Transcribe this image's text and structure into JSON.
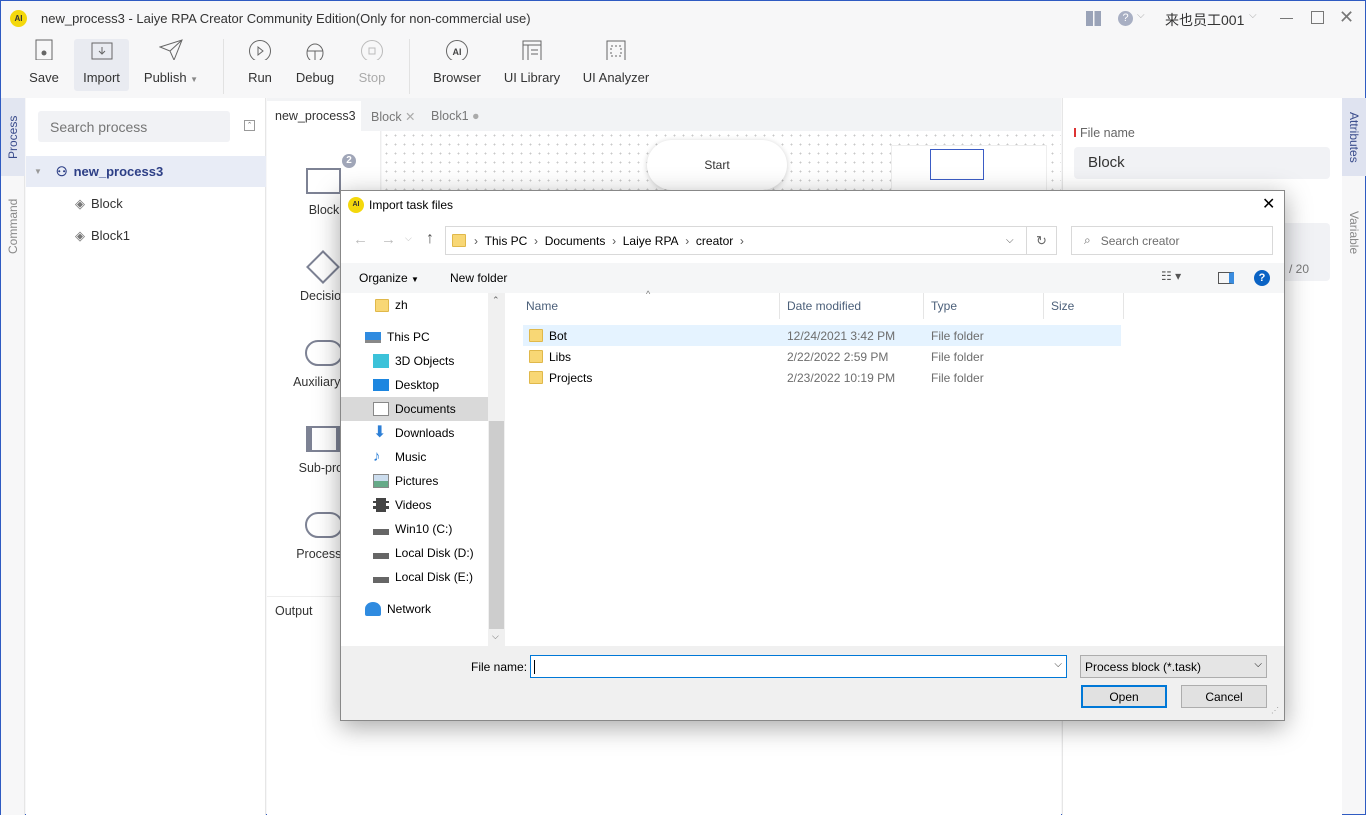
{
  "app": {
    "title": "new_process3 - Laiye RPA Creator Community Edition(Only for non-commercial use)",
    "user": "来也员工001",
    "accent": "#2f5bc2"
  },
  "toolbar": {
    "save": "Save",
    "import": "Import",
    "publish": "Publish",
    "run": "Run",
    "debug": "Debug",
    "stop": "Stop",
    "browser": "Browser",
    "ui_library": "UI Library",
    "ui_analyzer": "UI Analyzer"
  },
  "left_tabs": {
    "process": "Process",
    "command": "Command"
  },
  "process_panel": {
    "search_placeholder": "Search process",
    "tree": [
      {
        "label": "new_process3"
      },
      {
        "label": "Block"
      },
      {
        "label": "Block1"
      }
    ]
  },
  "editor_tabs": [
    {
      "label": "new_process3"
    },
    {
      "label": "Block"
    },
    {
      "label": "Block1"
    }
  ],
  "palette": {
    "badge": "2",
    "items": [
      "Block",
      "Decision",
      "Auxiliary pr",
      "Sub-proc",
      "Process e"
    ]
  },
  "canvas": {
    "start": "Start"
  },
  "output": {
    "tab": "Output"
  },
  "attributes": {
    "file_name_label": "File name",
    "file_name_value": "Block",
    "counter": "/ 20"
  },
  "right_tabs": {
    "attributes": "Attributes",
    "variable": "Variable"
  },
  "dialog": {
    "title": "Import task files",
    "breadcrumb": [
      "This PC",
      "Documents",
      "Laiye RPA",
      "creator"
    ],
    "search_placeholder": "Search creator",
    "organize": "Organize",
    "new_folder": "New folder",
    "nav": [
      {
        "label": "zh",
        "icon": "folder-icon"
      },
      {
        "label": "This PC",
        "icon": "computer-icon"
      },
      {
        "label": "3D Objects",
        "icon": "cube-icon"
      },
      {
        "label": "Desktop",
        "icon": "desktop-icon"
      },
      {
        "label": "Documents",
        "icon": "document-icon"
      },
      {
        "label": "Downloads",
        "icon": "download-icon"
      },
      {
        "label": "Music",
        "icon": "music-icon"
      },
      {
        "label": "Pictures",
        "icon": "picture-icon"
      },
      {
        "label": "Videos",
        "icon": "video-icon"
      },
      {
        "label": "Win10 (C:)",
        "icon": "drive-icon"
      },
      {
        "label": "Local Disk (D:)",
        "icon": "drive-icon"
      },
      {
        "label": "Local Disk (E:)",
        "icon": "drive-icon"
      },
      {
        "label": "Network",
        "icon": "network-icon"
      }
    ],
    "columns": [
      "Name",
      "Date modified",
      "Type",
      "Size"
    ],
    "files": [
      {
        "name": "Bot",
        "date": "12/24/2021 3:42 PM",
        "type": "File folder"
      },
      {
        "name": "Libs",
        "date": "2/22/2022 2:59 PM",
        "type": "File folder"
      },
      {
        "name": "Projects",
        "date": "2/23/2022 10:19 PM",
        "type": "File folder"
      }
    ],
    "file_name_label": "File name:",
    "file_name_value": "",
    "filter": "Process block (*.task)",
    "open": "Open",
    "cancel": "Cancel"
  }
}
